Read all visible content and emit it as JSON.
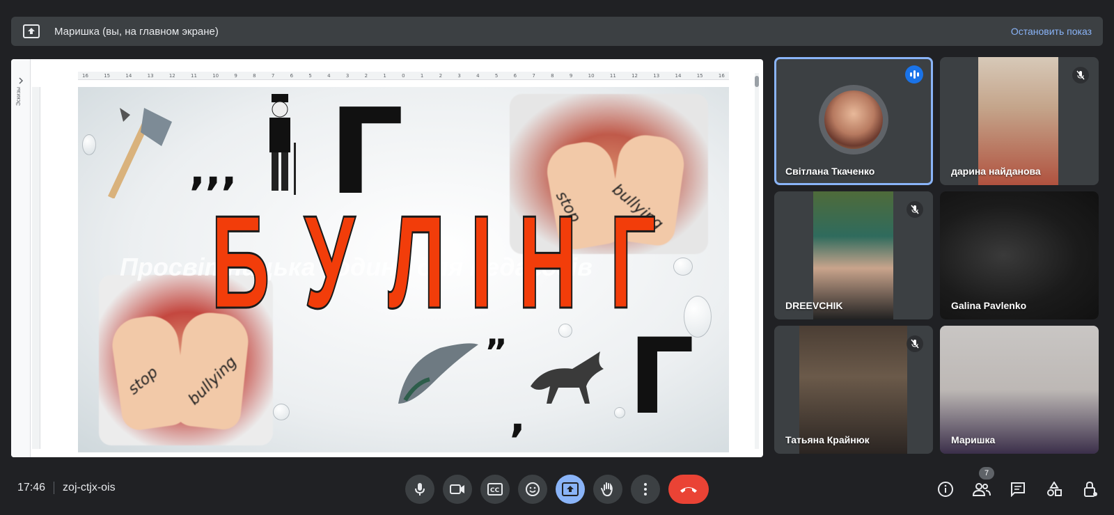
{
  "presentation_bar": {
    "title": "Маришка (вы, на главном экране)",
    "stop_label": "Остановить показ",
    "icon": "present-to-all-icon"
  },
  "shared_screen": {
    "side_tab_label": "Эскизы",
    "ruler_ticks": [
      "16",
      "15",
      "14",
      "13",
      "12",
      "11",
      "10",
      "9",
      "8",
      "7",
      "6",
      "5",
      "4",
      "3",
      "2",
      "1",
      "0",
      "1",
      "2",
      "3",
      "4",
      "5",
      "6",
      "7",
      "8",
      "9",
      "10",
      "11",
      "12",
      "13",
      "14",
      "15",
      "16"
    ],
    "slide": {
      "big_word_letters": [
        "Б",
        "У",
        "Л",
        "І",
        "Н",
        "Г"
      ],
      "ghost_text": "Просвітницька година для педагогів",
      "hand_text_1": "stop",
      "hand_text_2": "bullying",
      "decor_letter": "Г",
      "commas": ",,,",
      "quote_marks": "„"
    }
  },
  "participants": [
    {
      "name": "Світлана Ткаченко",
      "state": "speaking",
      "view": "avatar"
    },
    {
      "name": "дарина найданова",
      "state": "muted",
      "view": "video"
    },
    {
      "name": "DREEVCHIK",
      "state": "muted",
      "view": "video"
    },
    {
      "name": "Galina Pavlenko",
      "state": "unmuted",
      "view": "video"
    },
    {
      "name": "Татьяна Крайнюк",
      "state": "muted",
      "view": "video"
    },
    {
      "name": "Маришка",
      "state": "unmuted",
      "view": "video"
    }
  ],
  "bottom_bar": {
    "time": "17:46",
    "meeting_code": "zoj-ctjx-ois",
    "controls": [
      "mic-icon",
      "camera-icon",
      "captions-icon",
      "emoji-icon",
      "present-icon",
      "raise-hand-icon",
      "more-options-icon",
      "end-call-icon"
    ],
    "right_icons": [
      "info-icon",
      "people-icon",
      "chat-icon",
      "activities-icon",
      "host-controls-icon"
    ],
    "people_count": "7"
  },
  "colors": {
    "accent_blue": "#8ab4f8",
    "end_call_red": "#ea4335",
    "bullying_red": "#f23d0a",
    "background": "#202124",
    "tile_bg": "#3c4043"
  }
}
